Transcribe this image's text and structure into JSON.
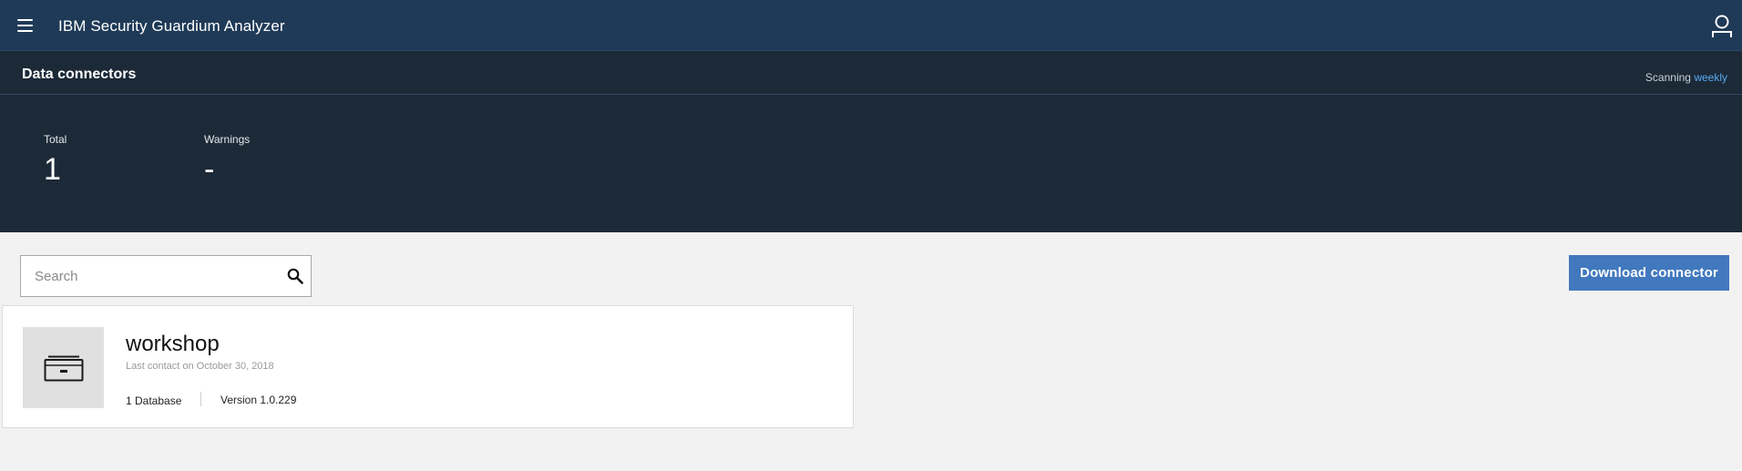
{
  "header": {
    "app_title": "IBM Security Guardium Analyzer",
    "menu_icon": "hamburger-menu-icon",
    "user_icon": "user-icon"
  },
  "subheader": {
    "title": "Data connectors",
    "scanning_label": "Scanning",
    "scanning_frequency": "weekly"
  },
  "stats": [
    {
      "label": "Total",
      "value": "1"
    },
    {
      "label": "Warnings",
      "value": "-"
    }
  ],
  "search": {
    "placeholder": "Search",
    "value": "",
    "icon": "search-icon"
  },
  "actions": {
    "download_label": "Download connector"
  },
  "connectors": [
    {
      "name": "workshop",
      "last_contact": "Last contact on October 30, 2018",
      "databases": "1 Database",
      "version": "Version 1.0.229",
      "icon": "archive-drawer-icon"
    }
  ],
  "colors": {
    "topbar": "#1f3a57",
    "dark_panel": "#1c2a38",
    "accent": "#4178be",
    "link": "#5aa9f5",
    "background": "#f2f2f2"
  }
}
